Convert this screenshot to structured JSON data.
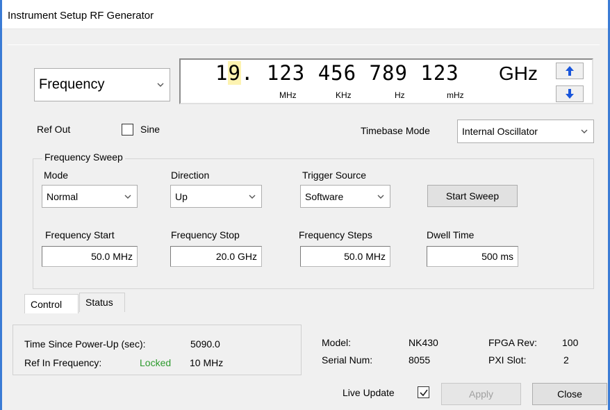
{
  "window": {
    "title": "Instrument Setup RF Generator"
  },
  "display": {
    "mode_select": "Frequency",
    "digits_hl": "9",
    "digits_pre": "1",
    "digits_post": ". 123 456 789 123",
    "unit": "GHz",
    "sublabels": [
      "MHz",
      "KHz",
      "Hz",
      "mHz"
    ],
    "up_icon": "arrow-up-icon",
    "down_icon": "arrow-down-icon"
  },
  "ref_out": {
    "label": "Ref Out",
    "sine_label": "Sine",
    "sine_checked": false
  },
  "timebase": {
    "label": "Timebase Mode",
    "value": "Internal Oscillator"
  },
  "sweep": {
    "group_label": "Frequency Sweep",
    "mode": {
      "label": "Mode",
      "value": "Normal"
    },
    "direction": {
      "label": "Direction",
      "value": "Up"
    },
    "trigger": {
      "label": "Trigger Source",
      "value": "Software"
    },
    "start_button": "Start Sweep",
    "freq_start": {
      "label": "Frequency Start",
      "value": "50.0 MHz"
    },
    "freq_stop": {
      "label": "Frequency Stop",
      "value": "20.0 GHz"
    },
    "freq_steps": {
      "label": "Frequency Steps",
      "value": "50.0 MHz"
    },
    "dwell": {
      "label": "Dwell Time",
      "value": "500 ms"
    }
  },
  "tabs": [
    {
      "label": "Control",
      "active": true
    },
    {
      "label": "Status",
      "active": false
    }
  ],
  "status": {
    "power_up_label": "Time Since Power-Up (sec):",
    "power_up_value": "5090.0",
    "ref_in_label": "Ref In Frequency:",
    "ref_in_state": "Locked",
    "ref_in_value": "10 MHz"
  },
  "info": {
    "model_label": "Model:",
    "model_value": "NK430",
    "serial_label": "Serial Num:",
    "serial_value": "8055",
    "fpga_label": "FPGA Rev:",
    "fpga_value": "100",
    "pxi_label": "PXI Slot:",
    "pxi_value": "2"
  },
  "footer": {
    "live_update_label": "Live Update",
    "live_update_checked": true,
    "apply_label": "Apply",
    "close_label": "Close"
  },
  "colors": {
    "accent": "#3a7bd5",
    "arrow": "#1a56db",
    "locked": "#2d9a2d",
    "highlight": "#fdf3b1"
  }
}
